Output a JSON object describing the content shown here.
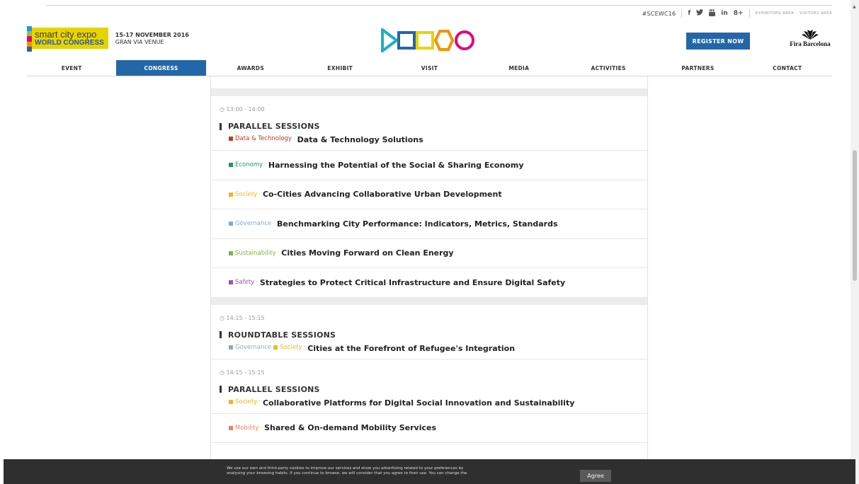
{
  "util": {
    "hashtag": "#SCEWC16",
    "social": [
      "f",
      "t",
      "yt",
      "in",
      "8+"
    ],
    "exhibitors_area": "EXHIBITORS AREA",
    "visitors_area": "VISITORS AREA"
  },
  "brand": {
    "line1": "smart city expo",
    "line2": "WORLD CONGRESS",
    "date": "15-17 NOVEMBER 2016",
    "venue": "GRAN VIA VENUE",
    "bar_colors": [
      "#1e9bd7",
      "#8dc63f",
      "#e6007e",
      "#f39200",
      "#2467a8"
    ]
  },
  "register_label": "REGISTER NOW",
  "fira_label": "Fira Barcelona",
  "nav": [
    "EVENT",
    "CONGRESS",
    "AWARDS",
    "EXHIBIT",
    "VISIT",
    "MEDIA",
    "ACTIVITIES",
    "PARTNERS",
    "CONTACT"
  ],
  "nav_active_index": 1,
  "blocks": [
    {
      "time": "13:00 - 14:00",
      "type": "PARALLEL SESSIONS",
      "items": [
        {
          "cats": [
            {
              "name": "Data & Technology",
              "color": "#c0392b"
            }
          ],
          "title": "Data & Technology Solutions"
        },
        {
          "cats": [
            {
              "name": "Economy",
              "color": "#1a9b5b"
            }
          ],
          "title": "Harnessing the Potential of the Social & Sharing Economy"
        },
        {
          "cats": [
            {
              "name": "Society",
              "color": "#f0b429"
            }
          ],
          "title": "Co-Cities Advancing Collaborative Urban Development"
        },
        {
          "cats": [
            {
              "name": "Governance",
              "color": "#8fa7bf"
            }
          ],
          "title": "Benchmarking City Performance: Indicators, Metrics, Standards"
        },
        {
          "cats": [
            {
              "name": "Sustainability",
              "color": "#7ab648"
            }
          ],
          "title": "Cities Moving Forward on Clean Energy"
        },
        {
          "cats": [
            {
              "name": "Safety",
              "color": "#a0569e"
            }
          ],
          "title": "Strategies to Protect Critical Infrastructure and Ensure Digital Safety"
        }
      ]
    },
    {
      "time": "14:15 - 15:15",
      "type": "ROUNDTABLE SESSIONS",
      "items": [
        {
          "cats": [
            {
              "name": "Governance",
              "color": "#8fa7bf"
            },
            {
              "name": "Society",
              "color": "#f0b429"
            }
          ],
          "title": "Cities at the Forefront of Refugee's Integration"
        }
      ]
    },
    {
      "time": "14:15 - 15:15",
      "type": "PARALLEL SESSIONS",
      "items": [
        {
          "cats": [
            {
              "name": "Society",
              "color": "#f0b429"
            }
          ],
          "title": "Collaborative Platforms for Digital Social Innovation and Sustainability"
        },
        {
          "cats": [
            {
              "name": "Mobility",
              "color": "#e8836b"
            }
          ],
          "title": "Shared & On-demand Mobility Services"
        }
      ]
    }
  ],
  "cookie": {
    "line1": "We use our own and third-party cookies to improve our services and show you advertising related to your preferences by",
    "line2": "analysing your browsing habits. If you continue to browse, we will consider that you agree to their use. You can change the",
    "agree_label": "Agree"
  }
}
